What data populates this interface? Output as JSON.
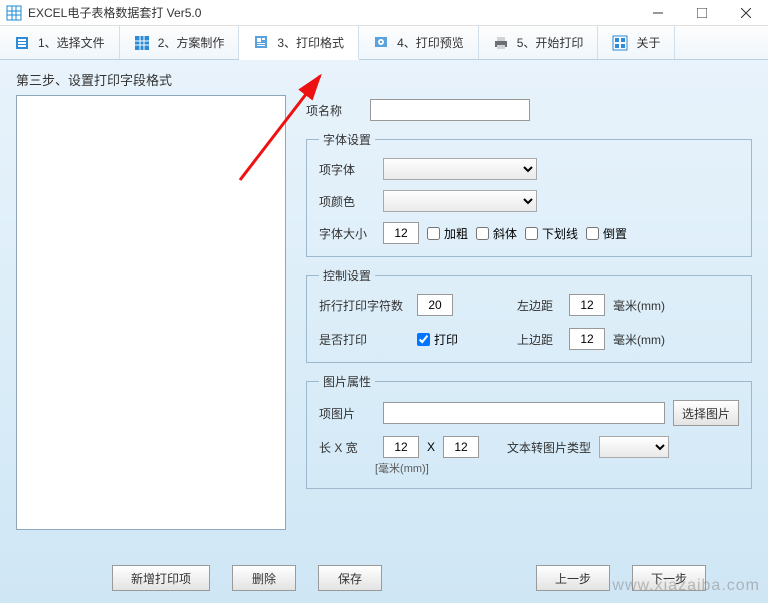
{
  "window": {
    "title": "EXCEL电子表格数据套打 Ver5.0"
  },
  "toolbar": {
    "items": [
      {
        "label": "1、选择文件"
      },
      {
        "label": "2、方案制作"
      },
      {
        "label": "3、打印格式"
      },
      {
        "label": "4、打印预览"
      },
      {
        "label": "5、开始打印"
      },
      {
        "label": "关于"
      }
    ]
  },
  "step_title": "第三步、设置打印字段格式",
  "form": {
    "field_name_label": "项名称",
    "font_settings_legend": "字体设置",
    "font_label": "项字体",
    "color_label": "项颜色",
    "size_label": "字体大小",
    "size_value": "12",
    "bold_label": "加粗",
    "italic_label": "斜体",
    "underline_label": "下划线",
    "invert_label": "倒置",
    "control_legend": "控制设置",
    "wrap_label": "折行打印字符数",
    "wrap_value": "20",
    "print_switch_label": "是否打印",
    "print_checkbox_label": "打印",
    "left_margin_label": "左边距",
    "left_margin_value": "12",
    "top_margin_label": "上边距",
    "top_margin_value": "12",
    "mm_unit": "毫米(mm)",
    "image_legend": "图片属性",
    "image_field_label": "项图片",
    "choose_image_btn": "选择图片",
    "wh_label": "长 X 宽",
    "w_value": "12",
    "h_value": "12",
    "x_sep": "X",
    "mm_unit2": "[毫米(mm)]",
    "text2img_label": "文本转图片类型"
  },
  "buttons": {
    "add": "新增打印项",
    "delete": "删除",
    "save": "保存",
    "prev": "上一步",
    "next": "下一步"
  },
  "watermark": "www.xiazaiba.com"
}
